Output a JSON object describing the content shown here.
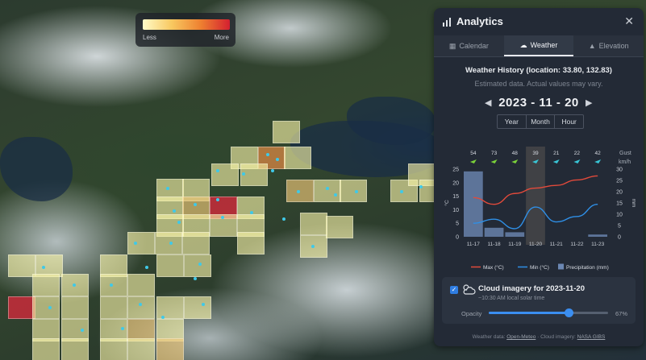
{
  "legend": {
    "less_label": "Less",
    "more_label": "More"
  },
  "panel": {
    "title": "Analytics",
    "close_icon": "close-icon",
    "tabs": [
      {
        "label": "Calendar",
        "icon": "calendar-icon"
      },
      {
        "label": "Weather",
        "icon": "weather-icon",
        "active": true
      },
      {
        "label": "Elevation",
        "icon": "elevation-icon"
      }
    ],
    "weather_history": "Weather History (location: 33.80, 132.83)",
    "estimated_note": "Estimated data. Actual values may vary.",
    "date_label": "2023 - 11 - 20",
    "range_buttons": [
      "Year",
      "Month",
      "Hour"
    ],
    "cloud": {
      "title": "Cloud imagery for 2023-11-20",
      "subtitle": "~10:30 AM local solar time",
      "opacity_label": "Opacity",
      "opacity_value": "67%",
      "opacity_fraction": 0.67,
      "checked": true
    },
    "footer": {
      "weather_prefix": "Weather data:",
      "weather_source": "Open-Meteo",
      "separator": "·",
      "imagery_prefix": "Cloud imagery:",
      "imagery_source": "NASA GIBS"
    }
  },
  "colors": {
    "max_line": "#e24a3b",
    "min_line": "#2f8fe6",
    "precip_bar": "#6b87b3",
    "highlight": "#5a5352",
    "gust_arrow_green": "#7bd23a",
    "gust_arrow_teal": "#39c6d6"
  },
  "chart_data": {
    "type": "bar",
    "categories": [
      "11-17",
      "11-18",
      "11-19",
      "11-20",
      "11-21",
      "11-22",
      "11-23"
    ],
    "highlight_category": "11-20",
    "gust_label": "Gust",
    "gust_unit": "km/h",
    "gust_values": [
      54,
      73,
      48,
      39,
      21,
      22,
      42
    ],
    "temp_axis_unit": "°C",
    "temp_ylim": [
      0,
      25
    ],
    "temp_ticks": [
      0,
      5,
      10,
      15,
      20,
      25
    ],
    "precip_axis_unit": "mm",
    "precip_ylim": [
      0,
      30
    ],
    "precip_ticks": [
      0,
      5,
      10,
      15,
      20,
      25,
      30
    ],
    "series": [
      {
        "name": "Max (°C)",
        "kind": "line",
        "values": [
          14.5,
          12,
          16,
          18,
          19,
          21,
          22.5
        ]
      },
      {
        "name": "Min (°C)",
        "kind": "line",
        "values": [
          5,
          6.5,
          3,
          11,
          5.5,
          7.5,
          12
        ]
      },
      {
        "name": "Precipitation (mm)",
        "kind": "bar",
        "values": [
          29,
          4,
          2,
          0,
          0,
          0,
          1
        ]
      }
    ],
    "legend": [
      "Max (°C)",
      "Min (°C)",
      "Precipitation (mm)"
    ],
    "legend_position": "bottom"
  }
}
